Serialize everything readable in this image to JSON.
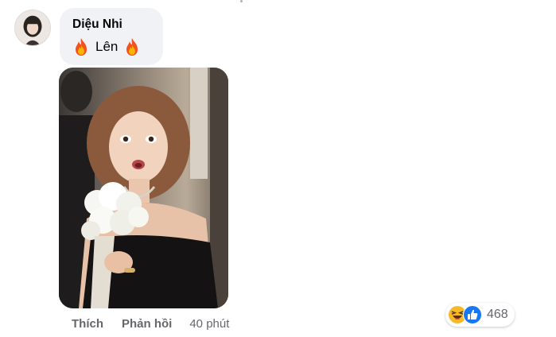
{
  "comment": {
    "author": "Diệu Nhi",
    "text": "Lên",
    "emoji_icon": "fire-icon"
  },
  "actions": {
    "like_label": "Thích",
    "reply_label": "Phản hồi",
    "timestamp": "40 phút"
  },
  "reactions": {
    "icons": [
      "laughing-face-icon",
      "thumbs-up-icon"
    ],
    "count": "468"
  },
  "colors": {
    "bubble_bg": "#f0f2f5",
    "secondary_text": "#65676b",
    "like_blue": "#1877f2",
    "haha_yellow": "#f7b928"
  }
}
